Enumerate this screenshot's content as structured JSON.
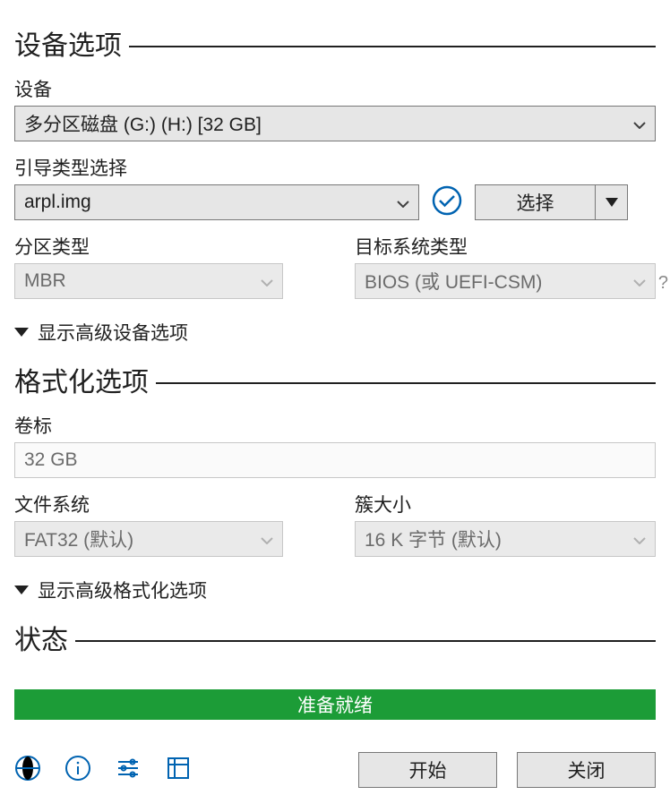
{
  "sections": {
    "device_options": "设备选项",
    "format_options": "格式化选项",
    "status": "状态"
  },
  "device": {
    "label": "设备",
    "value": "多分区磁盘 (G:) (H:) [32 GB]"
  },
  "boot": {
    "label": "引导类型选择",
    "value": "arpl.img",
    "select_button": "选择"
  },
  "partition": {
    "label": "分区类型",
    "value": "MBR"
  },
  "target_system": {
    "label": "目标系统类型",
    "value": "BIOS (或 UEFI-CSM)",
    "help": "?"
  },
  "adv_device_toggle": "显示高级设备选项",
  "volume": {
    "label": "卷标",
    "value": "32 GB"
  },
  "filesystem": {
    "label": "文件系统",
    "value": "FAT32 (默认)"
  },
  "cluster": {
    "label": "簇大小",
    "value": "16 K 字节 (默认)"
  },
  "adv_format_toggle": "显示高级格式化选项",
  "status_text": "准备就绪",
  "footer": {
    "start": "开始",
    "close": "关闭"
  }
}
